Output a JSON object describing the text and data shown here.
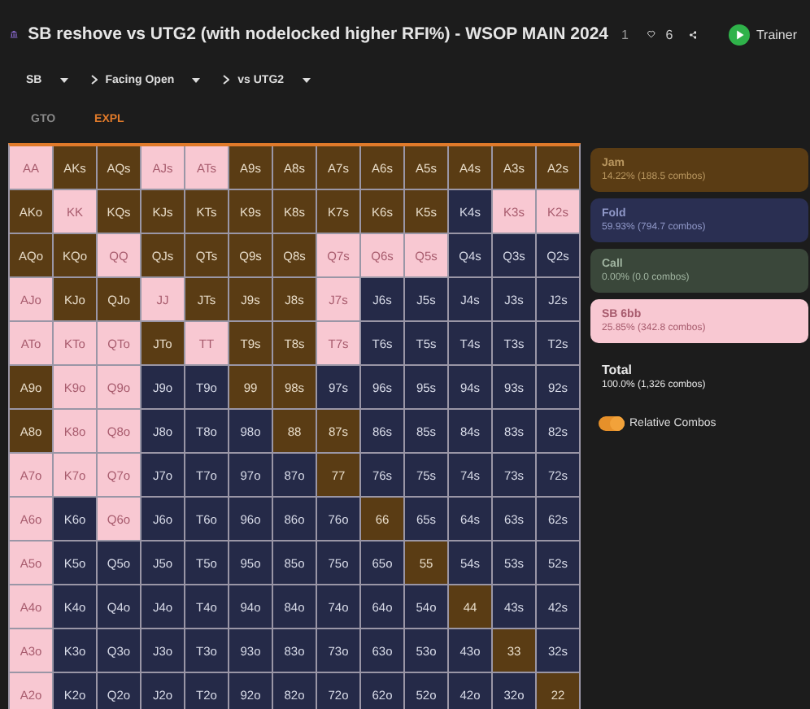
{
  "header": {
    "title": "SB reshove vs UTG2 (with nodelocked higher RFI%) - WSOP MAIN 2024",
    "title_suffix": "1",
    "likes": "6",
    "trainer": "Trainer"
  },
  "breadcrumb": [
    {
      "label": "SB",
      "chevron": false
    },
    {
      "label": "Facing Open",
      "chevron": true
    },
    {
      "label": "vs UTG2",
      "chevron": true
    }
  ],
  "tabs": [
    {
      "label": "GTO",
      "selected": false
    },
    {
      "label": "EXPL",
      "selected": true
    }
  ],
  "grid": {
    "rows": [
      [
        {
          "label": "AA",
          "kind": "raise"
        },
        {
          "label": "AKs",
          "kind": "jam"
        },
        {
          "label": "AQs",
          "kind": "jam"
        },
        {
          "label": "AJs",
          "kind": "raise"
        },
        {
          "label": "ATs",
          "kind": "raise"
        },
        {
          "label": "A9s",
          "kind": "jam"
        },
        {
          "label": "A8s",
          "kind": "jam"
        },
        {
          "label": "A7s",
          "kind": "jam"
        },
        {
          "label": "A6s",
          "kind": "jam"
        },
        {
          "label": "A5s",
          "kind": "jam"
        },
        {
          "label": "A4s",
          "kind": "jam"
        },
        {
          "label": "A3s",
          "kind": "jam"
        },
        {
          "label": "A2s",
          "kind": "jam"
        }
      ],
      [
        {
          "label": "AKo",
          "kind": "jam"
        },
        {
          "label": "KK",
          "kind": "raise"
        },
        {
          "label": "KQs",
          "kind": "jam"
        },
        {
          "label": "KJs",
          "kind": "jam"
        },
        {
          "label": "KTs",
          "kind": "jam"
        },
        {
          "label": "K9s",
          "kind": "jam"
        },
        {
          "label": "K8s",
          "kind": "jam"
        },
        {
          "label": "K7s",
          "kind": "jam"
        },
        {
          "label": "K6s",
          "kind": "jam"
        },
        {
          "label": "K5s",
          "kind": "jam"
        },
        {
          "label": "K4s",
          "kind": "fold"
        },
        {
          "label": "K3s",
          "kind": "raise"
        },
        {
          "label": "K2s",
          "kind": "raise"
        }
      ],
      [
        {
          "label": "AQo",
          "kind": "jam"
        },
        {
          "label": "KQo",
          "kind": "jam"
        },
        {
          "label": "QQ",
          "kind": "raise"
        },
        {
          "label": "QJs",
          "kind": "jam"
        },
        {
          "label": "QTs",
          "kind": "jam"
        },
        {
          "label": "Q9s",
          "kind": "jam"
        },
        {
          "label": "Q8s",
          "kind": "jam"
        },
        {
          "label": "Q7s",
          "kind": "raise"
        },
        {
          "label": "Q6s",
          "kind": "raise"
        },
        {
          "label": "Q5s",
          "kind": "raise"
        },
        {
          "label": "Q4s",
          "kind": "fold"
        },
        {
          "label": "Q3s",
          "kind": "fold"
        },
        {
          "label": "Q2s",
          "kind": "fold"
        }
      ],
      [
        {
          "label": "AJo",
          "kind": "raise"
        },
        {
          "label": "KJo",
          "kind": "jam"
        },
        {
          "label": "QJo",
          "kind": "jam"
        },
        {
          "label": "JJ",
          "kind": "raise"
        },
        {
          "label": "JTs",
          "kind": "jam"
        },
        {
          "label": "J9s",
          "kind": "jam"
        },
        {
          "label": "J8s",
          "kind": "jam"
        },
        {
          "label": "J7s",
          "kind": "raise"
        },
        {
          "label": "J6s",
          "kind": "fold"
        },
        {
          "label": "J5s",
          "kind": "fold"
        },
        {
          "label": "J4s",
          "kind": "fold"
        },
        {
          "label": "J3s",
          "kind": "fold"
        },
        {
          "label": "J2s",
          "kind": "fold"
        }
      ],
      [
        {
          "label": "ATo",
          "kind": "raise"
        },
        {
          "label": "KTo",
          "kind": "raise"
        },
        {
          "label": "QTo",
          "kind": "raise"
        },
        {
          "label": "JTo",
          "kind": "jam"
        },
        {
          "label": "TT",
          "kind": "raise"
        },
        {
          "label": "T9s",
          "kind": "jam"
        },
        {
          "label": "T8s",
          "kind": "jam"
        },
        {
          "label": "T7s",
          "kind": "raise"
        },
        {
          "label": "T6s",
          "kind": "fold"
        },
        {
          "label": "T5s",
          "kind": "fold"
        },
        {
          "label": "T4s",
          "kind": "fold"
        },
        {
          "label": "T3s",
          "kind": "fold"
        },
        {
          "label": "T2s",
          "kind": "fold"
        }
      ],
      [
        {
          "label": "A9o",
          "kind": "jam"
        },
        {
          "label": "K9o",
          "kind": "raise"
        },
        {
          "label": "Q9o",
          "kind": "raise"
        },
        {
          "label": "J9o",
          "kind": "fold"
        },
        {
          "label": "T9o",
          "kind": "fold"
        },
        {
          "label": "99",
          "kind": "jam"
        },
        {
          "label": "98s",
          "kind": "jam"
        },
        {
          "label": "97s",
          "kind": "fold"
        },
        {
          "label": "96s",
          "kind": "fold"
        },
        {
          "label": "95s",
          "kind": "fold"
        },
        {
          "label": "94s",
          "kind": "fold"
        },
        {
          "label": "93s",
          "kind": "fold"
        },
        {
          "label": "92s",
          "kind": "fold"
        }
      ],
      [
        {
          "label": "A8o",
          "kind": "jam"
        },
        {
          "label": "K8o",
          "kind": "raise"
        },
        {
          "label": "Q8o",
          "kind": "raise"
        },
        {
          "label": "J8o",
          "kind": "fold"
        },
        {
          "label": "T8o",
          "kind": "fold"
        },
        {
          "label": "98o",
          "kind": "fold"
        },
        {
          "label": "88",
          "kind": "jam"
        },
        {
          "label": "87s",
          "kind": "jam"
        },
        {
          "label": "86s",
          "kind": "fold"
        },
        {
          "label": "85s",
          "kind": "fold"
        },
        {
          "label": "84s",
          "kind": "fold"
        },
        {
          "label": "83s",
          "kind": "fold"
        },
        {
          "label": "82s",
          "kind": "fold"
        }
      ],
      [
        {
          "label": "A7o",
          "kind": "raise"
        },
        {
          "label": "K7o",
          "kind": "raise"
        },
        {
          "label": "Q7o",
          "kind": "raise"
        },
        {
          "label": "J7o",
          "kind": "fold"
        },
        {
          "label": "T7o",
          "kind": "fold"
        },
        {
          "label": "97o",
          "kind": "fold"
        },
        {
          "label": "87o",
          "kind": "fold"
        },
        {
          "label": "77",
          "kind": "jam"
        },
        {
          "label": "76s",
          "kind": "fold"
        },
        {
          "label": "75s",
          "kind": "fold"
        },
        {
          "label": "74s",
          "kind": "fold"
        },
        {
          "label": "73s",
          "kind": "fold"
        },
        {
          "label": "72s",
          "kind": "fold"
        }
      ],
      [
        {
          "label": "A6o",
          "kind": "raise"
        },
        {
          "label": "K6o",
          "kind": "fold"
        },
        {
          "label": "Q6o",
          "kind": "raise"
        },
        {
          "label": "J6o",
          "kind": "fold"
        },
        {
          "label": "T6o",
          "kind": "fold"
        },
        {
          "label": "96o",
          "kind": "fold"
        },
        {
          "label": "86o",
          "kind": "fold"
        },
        {
          "label": "76o",
          "kind": "fold"
        },
        {
          "label": "66",
          "kind": "jam"
        },
        {
          "label": "65s",
          "kind": "fold"
        },
        {
          "label": "64s",
          "kind": "fold"
        },
        {
          "label": "63s",
          "kind": "fold"
        },
        {
          "label": "62s",
          "kind": "fold"
        }
      ],
      [
        {
          "label": "A5o",
          "kind": "raise"
        },
        {
          "label": "K5o",
          "kind": "fold"
        },
        {
          "label": "Q5o",
          "kind": "fold"
        },
        {
          "label": "J5o",
          "kind": "fold"
        },
        {
          "label": "T5o",
          "kind": "fold"
        },
        {
          "label": "95o",
          "kind": "fold"
        },
        {
          "label": "85o",
          "kind": "fold"
        },
        {
          "label": "75o",
          "kind": "fold"
        },
        {
          "label": "65o",
          "kind": "fold"
        },
        {
          "label": "55",
          "kind": "jam"
        },
        {
          "label": "54s",
          "kind": "fold"
        },
        {
          "label": "53s",
          "kind": "fold"
        },
        {
          "label": "52s",
          "kind": "fold"
        }
      ],
      [
        {
          "label": "A4o",
          "kind": "raise"
        },
        {
          "label": "K4o",
          "kind": "fold"
        },
        {
          "label": "Q4o",
          "kind": "fold"
        },
        {
          "label": "J4o",
          "kind": "fold"
        },
        {
          "label": "T4o",
          "kind": "fold"
        },
        {
          "label": "94o",
          "kind": "fold"
        },
        {
          "label": "84o",
          "kind": "fold"
        },
        {
          "label": "74o",
          "kind": "fold"
        },
        {
          "label": "64o",
          "kind": "fold"
        },
        {
          "label": "54o",
          "kind": "fold"
        },
        {
          "label": "44",
          "kind": "jam"
        },
        {
          "label": "43s",
          "kind": "fold"
        },
        {
          "label": "42s",
          "kind": "fold"
        }
      ],
      [
        {
          "label": "A3o",
          "kind": "raise"
        },
        {
          "label": "K3o",
          "kind": "fold"
        },
        {
          "label": "Q3o",
          "kind": "fold"
        },
        {
          "label": "J3o",
          "kind": "fold"
        },
        {
          "label": "T3o",
          "kind": "fold"
        },
        {
          "label": "93o",
          "kind": "fold"
        },
        {
          "label": "83o",
          "kind": "fold"
        },
        {
          "label": "73o",
          "kind": "fold"
        },
        {
          "label": "63o",
          "kind": "fold"
        },
        {
          "label": "53o",
          "kind": "fold"
        },
        {
          "label": "43o",
          "kind": "fold"
        },
        {
          "label": "33",
          "kind": "jam"
        },
        {
          "label": "32s",
          "kind": "fold"
        }
      ],
      [
        {
          "label": "A2o",
          "kind": "raise"
        },
        {
          "label": "K2o",
          "kind": "fold"
        },
        {
          "label": "Q2o",
          "kind": "fold"
        },
        {
          "label": "J2o",
          "kind": "fold"
        },
        {
          "label": "T2o",
          "kind": "fold"
        },
        {
          "label": "92o",
          "kind": "fold"
        },
        {
          "label": "82o",
          "kind": "fold"
        },
        {
          "label": "72o",
          "kind": "fold"
        },
        {
          "label": "62o",
          "kind": "fold"
        },
        {
          "label": "52o",
          "kind": "fold"
        },
        {
          "label": "42o",
          "kind": "fold"
        },
        {
          "label": "32o",
          "kind": "fold"
        },
        {
          "label": "22",
          "kind": "jam"
        }
      ]
    ]
  },
  "legend": [
    {
      "kind": "jam",
      "name": "Jam",
      "stats": "14.22% (188.5 combos)"
    },
    {
      "kind": "fold",
      "name": "Fold",
      "stats": "59.93% (794.7 combos)"
    },
    {
      "kind": "call",
      "name": "Call",
      "stats": "0.00% (0.0 combos)"
    },
    {
      "kind": "raise",
      "name": "SB 6bb",
      "stats": "25.85% (342.8 combos)"
    }
  ],
  "total": {
    "label": "Total",
    "stats": "100.0% (1,326 combos)"
  },
  "relative_combos": {
    "label": "Relative Combos",
    "on": true
  }
}
